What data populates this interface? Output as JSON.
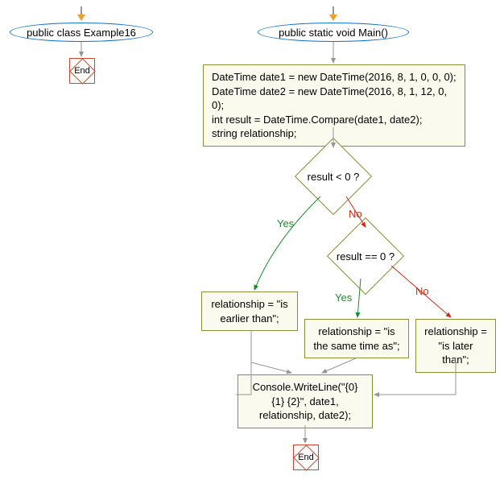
{
  "chart_data": {
    "type": "flowchart",
    "nodes": [
      {
        "id": "start1",
        "kind": "start",
        "label": "public class Example16"
      },
      {
        "id": "end1",
        "kind": "end",
        "label": "End"
      },
      {
        "id": "start2",
        "kind": "start",
        "label": "public static void Main()"
      },
      {
        "id": "p1",
        "kind": "process",
        "label": "DateTime date1 = new DateTime(2016, 8, 1, 0, 0, 0);\nDateTime date2 = new DateTime(2016, 8, 1, 12, 0, 0);\nint result = DateTime.Compare(date1, date2);\nstring relationship;"
      },
      {
        "id": "d1",
        "kind": "decision",
        "label": "result < 0 ?"
      },
      {
        "id": "d2",
        "kind": "decision",
        "label": "result == 0 ?"
      },
      {
        "id": "p2",
        "kind": "process",
        "label": "relationship = \"is earlier than\";"
      },
      {
        "id": "p3",
        "kind": "process",
        "label": "relationship = \"is the same time as\";"
      },
      {
        "id": "p4",
        "kind": "process",
        "label": "relationship = \"is later than\";"
      },
      {
        "id": "p5",
        "kind": "process",
        "label": "Console.WriteLine(\"{0} {1} {2}\", date1, relationship, date2);"
      },
      {
        "id": "end2",
        "kind": "end",
        "label": "End"
      }
    ],
    "edges": [
      {
        "from": "start1",
        "to": "end1"
      },
      {
        "from": "start2",
        "to": "p1"
      },
      {
        "from": "p1",
        "to": "d1"
      },
      {
        "from": "d1",
        "to": "p2",
        "label": "Yes"
      },
      {
        "from": "d1",
        "to": "d2",
        "label": "No"
      },
      {
        "from": "d2",
        "to": "p3",
        "label": "Yes"
      },
      {
        "from": "d2",
        "to": "p4",
        "label": "No"
      },
      {
        "from": "p2",
        "to": "p5"
      },
      {
        "from": "p3",
        "to": "p5"
      },
      {
        "from": "p4",
        "to": "p5"
      },
      {
        "from": "p5",
        "to": "end2"
      }
    ]
  },
  "labels": {
    "start1": "public class Example16",
    "end1": "End",
    "start2": "public static void Main()",
    "p1_l1": "DateTime date1 = new DateTime(2016, 8, 1, 0, 0, 0);",
    "p1_l2": "DateTime date2 = new DateTime(2016, 8, 1, 12, 0, 0);",
    "p1_l3": "int result = DateTime.Compare(date1, date2);",
    "p1_l4": "string relationship;",
    "d1": "result < 0 ?",
    "d2": "result == 0 ?",
    "p2_l1": "relationship = \"is",
    "p2_l2": "earlier than\";",
    "p3_l1": "relationship = \"is",
    "p3_l2": "the same time as\";",
    "p4_l1": "relationship =",
    "p4_l2": "\"is later than\";",
    "p5_l1": "Console.WriteLine(\"{0}",
    "p5_l2": "{1} {2}\", date1,",
    "p5_l3": "relationship, date2);",
    "end2": "End",
    "yes": "Yes",
    "no": "No"
  }
}
